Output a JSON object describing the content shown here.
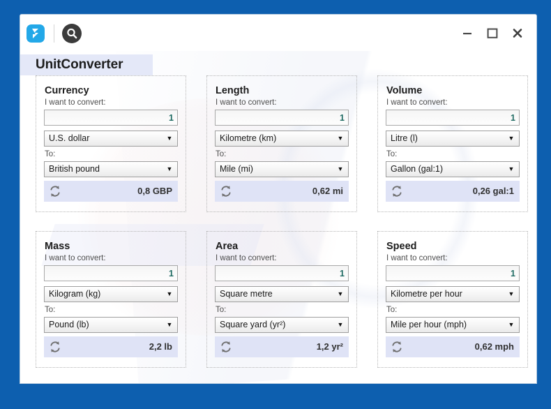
{
  "window": {
    "app_title": "UnitConverter",
    "app_icon": "app-logo-icon",
    "search_icon": "search-icon",
    "controls": {
      "minimize": "minimize-icon",
      "maximize": "maximize-icon",
      "close": "close-icon"
    }
  },
  "labels": {
    "convert_from": "I want to convert:",
    "convert_to": "To:",
    "swap_icon": "swap-icon"
  },
  "panels": [
    {
      "title": "Currency",
      "amount": "1",
      "amount_placeholder": "",
      "from_unit": "U.S. dollar",
      "to_unit": "British pound",
      "result": "0,8 GBP"
    },
    {
      "title": "Length",
      "amount": "1",
      "amount_placeholder": "",
      "from_unit": "Kilometre (km)",
      "to_unit": "Mile (mi)",
      "result": "0,62 mi"
    },
    {
      "title": "Volume",
      "amount": "1",
      "amount_placeholder": "",
      "from_unit": "Litre (l)",
      "to_unit": "Gallon (gal:1)",
      "result": "0,26 gal:1"
    },
    {
      "title": "Mass",
      "amount": "1",
      "amount_placeholder": "",
      "from_unit": "Kilogram (kg)",
      "to_unit": "Pound (lb)",
      "result": "2,2 lb"
    },
    {
      "title": "Area",
      "amount": "1",
      "amount_placeholder": "",
      "from_unit": "Square metre",
      "to_unit": "Square yard (yr²)",
      "result": "1,2 yr²"
    },
    {
      "title": "Speed",
      "amount": "1",
      "amount_placeholder": "",
      "from_unit": "Kilometre per hour",
      "to_unit": "Mile per hour (mph)",
      "result": "0,62 mph"
    }
  ],
  "colors": {
    "desktop_frame": "#0d5faf",
    "app_icon": "#23a8e8",
    "title_band": "#e4e8f8",
    "result_bar": "#dfe3f6",
    "input_value": "#1f6b63",
    "panel_border": "#b5b5b5"
  }
}
